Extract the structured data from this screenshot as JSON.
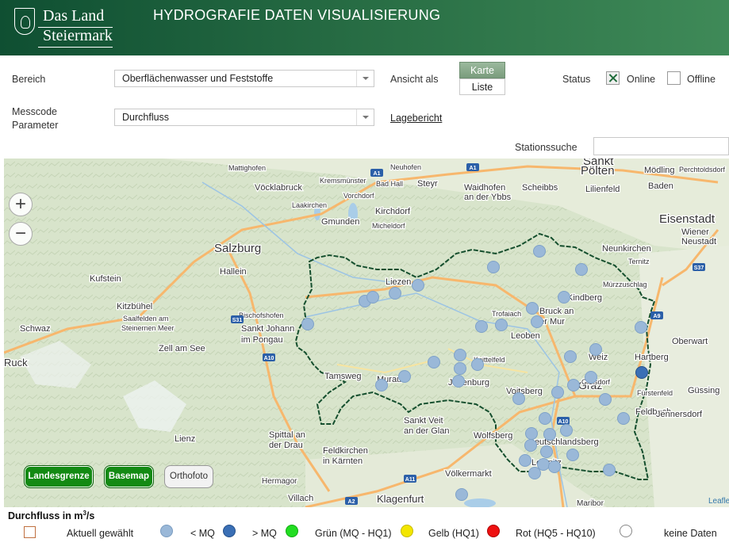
{
  "header": {
    "logo_line1": "Das Land",
    "logo_line2": "Steiermark",
    "title": "HYDROGRAFIE DATEN VISUALISIERUNG"
  },
  "filters": {
    "bereich_label": "Bereich",
    "bereich_value": "Oberflächenwasser und Feststoffe",
    "messcode_label1": "Messcode",
    "messcode_label2": "Parameter",
    "parameter_value": "Durchfluss",
    "ansicht_label": "Ansicht als",
    "view_karte": "Karte",
    "view_liste": "Liste",
    "lagebericht_link": "Lagebericht",
    "status_label": "Status",
    "status_online": "Online",
    "status_offline": "Offline",
    "stationssuche_label": "Stationssuche",
    "stationssuche_value": ""
  },
  "map": {
    "zoom_in": "+",
    "zoom_out": "−",
    "places": [
      {
        "name": "Salzburg"
      },
      {
        "name": "Hallein"
      },
      {
        "name": "Kufstein"
      },
      {
        "name": "Kitzbühel"
      },
      {
        "name": "Saalfelden am"
      },
      {
        "name": "Steinernen Meer"
      },
      {
        "name": "Zell am See"
      },
      {
        "name": "Schwaz"
      },
      {
        "name": "Bischofshofen"
      },
      {
        "name": "Sankt Johann"
      },
      {
        "name": "im Pongau"
      },
      {
        "name": "Lienz"
      },
      {
        "name": "Spittal an"
      },
      {
        "name": "der Drau"
      },
      {
        "name": "Hermagor"
      },
      {
        "name": "Villach"
      },
      {
        "name": "Feldkirchen"
      },
      {
        "name": "in Kärnten"
      },
      {
        "name": "Klagenfurt"
      },
      {
        "name": "Völkermarkt"
      },
      {
        "name": "Sankt Veit"
      },
      {
        "name": "an der Glan"
      },
      {
        "name": "Wolfsberg"
      },
      {
        "name": "Deutschlandsberg"
      },
      {
        "name": "Leibnitz"
      },
      {
        "name": "Graz"
      },
      {
        "name": "Voitsberg"
      },
      {
        "name": "Gleisdorf"
      },
      {
        "name": "Weiz"
      },
      {
        "name": "Feldbach"
      },
      {
        "name": "Fürstenfeld"
      },
      {
        "name": "Jennersdorf"
      },
      {
        "name": "Güssing"
      },
      {
        "name": "Hartberg"
      },
      {
        "name": "Oberwart"
      },
      {
        "name": "Bruck an"
      },
      {
        "name": "der Mur"
      },
      {
        "name": "Leoben"
      },
      {
        "name": "Trofaiach"
      },
      {
        "name": "Knittelfeld"
      },
      {
        "name": "Judenburg"
      },
      {
        "name": "Murau"
      },
      {
        "name": "Tamsweg"
      },
      {
        "name": "Liezen"
      },
      {
        "name": "Mürzzuschlag"
      },
      {
        "name": "Kindberg"
      },
      {
        "name": "Neunkirchen"
      },
      {
        "name": "Ternitz"
      },
      {
        "name": "Wiener"
      },
      {
        "name": "Neustadt"
      },
      {
        "name": "Eisenstadt"
      },
      {
        "name": "Mödling"
      },
      {
        "name": "Baden"
      },
      {
        "name": "Lilienfeld"
      },
      {
        "name": "Sankt"
      },
      {
        "name": "Pölten"
      },
      {
        "name": "Scheibbs"
      },
      {
        "name": "Waidhofen"
      },
      {
        "name": "an der Ybbs"
      },
      {
        "name": "Steyr"
      },
      {
        "name": "Kirchdorf"
      },
      {
        "name": "Micheldorf"
      },
      {
        "name": "Gmunden"
      },
      {
        "name": "Vöcklabruck"
      },
      {
        "name": "Mattighofen"
      },
      {
        "name": "Laakirchen"
      },
      {
        "name": "Kremsmünster"
      },
      {
        "name": "Bad Hall"
      },
      {
        "name": "Neuhofen"
      },
      {
        "name": "Vorchdorf"
      },
      {
        "name": "Perchtoldsdorf"
      },
      {
        "name": "Ruck"
      },
      {
        "name": "Maribor"
      }
    ],
    "roads": [
      "A1",
      "A1",
      "A10",
      "A10",
      "A9",
      "A2",
      "A11",
      "S37",
      "S31"
    ],
    "stations_count": 48
  },
  "buttons": {
    "landesgrenze": "Landesgrenze",
    "basemap": "Basemap",
    "orthofoto": "Orthofoto",
    "leaflet": "Leaflet"
  },
  "legend": {
    "title": "Durchfluss in m",
    "title_sup": "3",
    "title_suffix": "/s",
    "aktuell": "Aktuell gewählt",
    "lt_mq": "< MQ",
    "gt_mq": "> MQ",
    "gruen": "Grün (MQ - HQ1)",
    "gelb": "Gelb (HQ1)",
    "rot": "Rot (HQ5 - HQ10)",
    "keine": "keine Daten"
  },
  "colors": {
    "header_green": "#1f5f3d",
    "lt_mq": "#9ab8d8",
    "gt_mq": "#3a6fb5",
    "gruen": "#22dd22",
    "gelb": "#f3e600",
    "rot": "#ee1111",
    "border": "#154f2e"
  }
}
